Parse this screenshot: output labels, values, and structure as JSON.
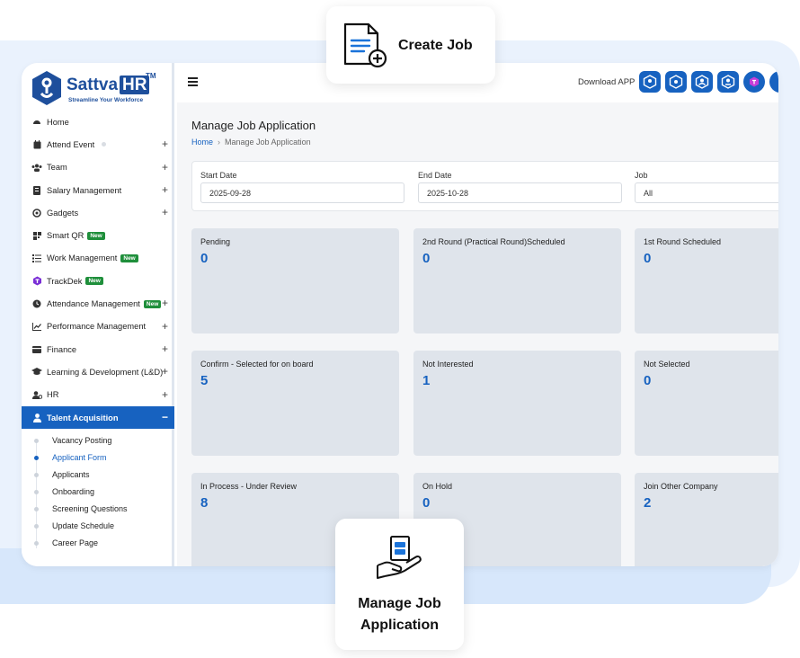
{
  "app": {
    "brand": "Sattva",
    "brand_hr": "HR",
    "brand_tm": "TM",
    "tagline": "Streamline Your Workforce"
  },
  "sidebar": {
    "items": [
      {
        "label": "Home",
        "icon": "dashboard-icon",
        "expandable": false
      },
      {
        "label": "Attend Event",
        "icon": "calendar-icon",
        "expandable": true
      },
      {
        "label": "Team",
        "icon": "team-icon",
        "expandable": true
      },
      {
        "label": "Salary Management",
        "icon": "salary-icon",
        "expandable": true
      },
      {
        "label": "Gadgets",
        "icon": "gadgets-icon",
        "expandable": true
      },
      {
        "label": "Smart QR",
        "icon": "qr-icon",
        "badge": "New",
        "expandable": false
      },
      {
        "label": "Work Management",
        "icon": "list-icon",
        "badge": "New",
        "expandable": false
      },
      {
        "label": "TrackDek",
        "icon": "trackdek-icon",
        "badge": "New",
        "expandable": false
      },
      {
        "label": "Attendance Management",
        "icon": "clock-icon",
        "badge": "New",
        "expandable": true
      },
      {
        "label": "Performance Management",
        "icon": "chart-icon",
        "expandable": true
      },
      {
        "label": "Finance",
        "icon": "finance-icon",
        "expandable": true
      },
      {
        "label": "Learning & Development (L&D)",
        "icon": "graduation-cap-icon",
        "expandable": true
      },
      {
        "label": "HR",
        "icon": "hr-icon",
        "expandable": true
      },
      {
        "label": "Talent Acquisition",
        "icon": "user-icon",
        "expandable": true,
        "active": true
      }
    ],
    "sub_items": [
      {
        "label": "Vacancy Posting"
      },
      {
        "label": "Applicant Form",
        "current": true
      },
      {
        "label": "Applicants"
      },
      {
        "label": "Onboarding"
      },
      {
        "label": "Screening Questions"
      },
      {
        "label": "Update Schedule"
      },
      {
        "label": "Career Page"
      }
    ],
    "plus": "+",
    "minus": "−"
  },
  "topbar": {
    "download_label": "Download APP"
  },
  "page": {
    "title": "Manage Job Application",
    "breadcrumb_home": "Home",
    "breadcrumb_sep": "›",
    "breadcrumb_current": "Manage Job Application"
  },
  "filters": {
    "start_label": "Start Date",
    "start_value": "2025-09-28",
    "end_label": "End Date",
    "end_value": "2025-10-28",
    "job_label": "Job",
    "job_value": "All"
  },
  "cards": [
    {
      "label": "Pending",
      "value": "0"
    },
    {
      "label": "2nd Round (Practical Round)Scheduled",
      "value": "0"
    },
    {
      "label": "1st Round Scheduled",
      "value": "0"
    },
    {
      "label": "Confirm - Selected for on board",
      "value": "5"
    },
    {
      "label": "Not Interested",
      "value": "1"
    },
    {
      "label": "Not Selected",
      "value": "0"
    },
    {
      "label": "In Process - Under Review",
      "value": "8"
    },
    {
      "label": "On Hold",
      "value": "0"
    },
    {
      "label": "Join Other Company",
      "value": "2"
    }
  ],
  "callouts": {
    "create_job": "Create Job",
    "manage_line1": "Manage Job",
    "manage_line2": "Application"
  },
  "colors": {
    "primary": "#1762c0",
    "badge_green": "#1f8f3b",
    "card_bg": "#dfe4eb"
  }
}
